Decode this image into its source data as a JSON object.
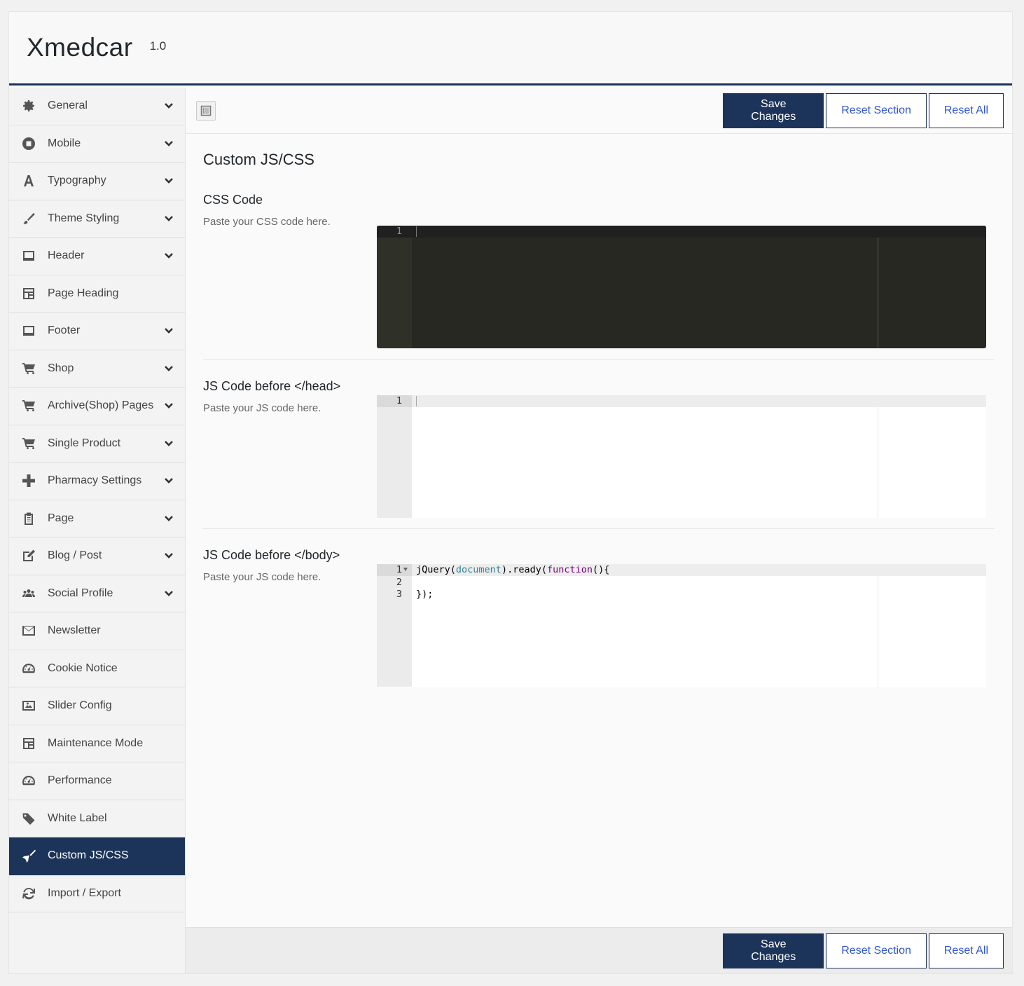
{
  "app": {
    "title": "Xmedcar",
    "version": "1.0"
  },
  "sidebar": {
    "items": [
      {
        "label": "General",
        "icon": "gear-icon",
        "has_children": true,
        "active": false
      },
      {
        "label": "Mobile",
        "icon": "mobile-icon",
        "has_children": true,
        "active": false
      },
      {
        "label": "Typography",
        "icon": "font-icon",
        "has_children": true,
        "active": false
      },
      {
        "label": "Theme Styling",
        "icon": "brush-icon",
        "has_children": true,
        "active": false
      },
      {
        "label": "Header",
        "icon": "header-icon",
        "has_children": true,
        "active": false
      },
      {
        "label": "Page Heading",
        "icon": "layout-icon",
        "has_children": false,
        "active": false
      },
      {
        "label": "Footer",
        "icon": "footer-icon",
        "has_children": true,
        "active": false
      },
      {
        "label": "Shop",
        "icon": "cart-icon",
        "has_children": true,
        "active": false
      },
      {
        "label": "Archive(Shop) Pages",
        "icon": "cart-icon",
        "has_children": true,
        "active": false
      },
      {
        "label": "Single Product",
        "icon": "cart-icon",
        "has_children": true,
        "active": false
      },
      {
        "label": "Pharmacy Settings",
        "icon": "plus-icon",
        "has_children": true,
        "active": false
      },
      {
        "label": "Page",
        "icon": "clipboard-icon",
        "has_children": true,
        "active": false
      },
      {
        "label": "Blog / Post",
        "icon": "edit-icon",
        "has_children": true,
        "active": false
      },
      {
        "label": "Social Profile",
        "icon": "users-icon",
        "has_children": true,
        "active": false
      },
      {
        "label": "Newsletter",
        "icon": "envelope-icon",
        "has_children": false,
        "active": false
      },
      {
        "label": "Cookie Notice",
        "icon": "dashboard-icon",
        "has_children": false,
        "active": false
      },
      {
        "label": "Slider Config",
        "icon": "picture-icon",
        "has_children": false,
        "active": false
      },
      {
        "label": "Maintenance Mode",
        "icon": "layout-icon",
        "has_children": false,
        "active": false
      },
      {
        "label": "Performance",
        "icon": "dashboard-icon",
        "has_children": false,
        "active": false
      },
      {
        "label": "White Label",
        "icon": "tag-icon",
        "has_children": false,
        "active": false
      },
      {
        "label": "Custom JS/CSS",
        "icon": "broom-icon",
        "has_children": false,
        "active": true
      },
      {
        "label": "Import / Export",
        "icon": "refresh-icon",
        "has_children": false,
        "active": false
      }
    ]
  },
  "toolbar": {
    "save_label": "Save Changes",
    "reset_section_label": "Reset Section",
    "reset_all_label": "Reset All"
  },
  "section": {
    "title": "Custom JS/CSS",
    "fields": [
      {
        "label": "CSS Code",
        "description": "Paste your CSS code here.",
        "theme": "dark",
        "lines": [
          ""
        ]
      },
      {
        "label": "JS Code before </head>",
        "description": "Paste your JS code here.",
        "theme": "light",
        "lines": [
          ""
        ]
      },
      {
        "label": "JS Code before </body>",
        "description": "Paste your JS code here.",
        "theme": "light",
        "lines": [
          "jQuery(document).ready(function(){",
          "",
          "});"
        ]
      }
    ]
  },
  "colors": {
    "accent": "#1c3459",
    "link": "#2f55d4",
    "editor_dark_bg": "#272822"
  }
}
